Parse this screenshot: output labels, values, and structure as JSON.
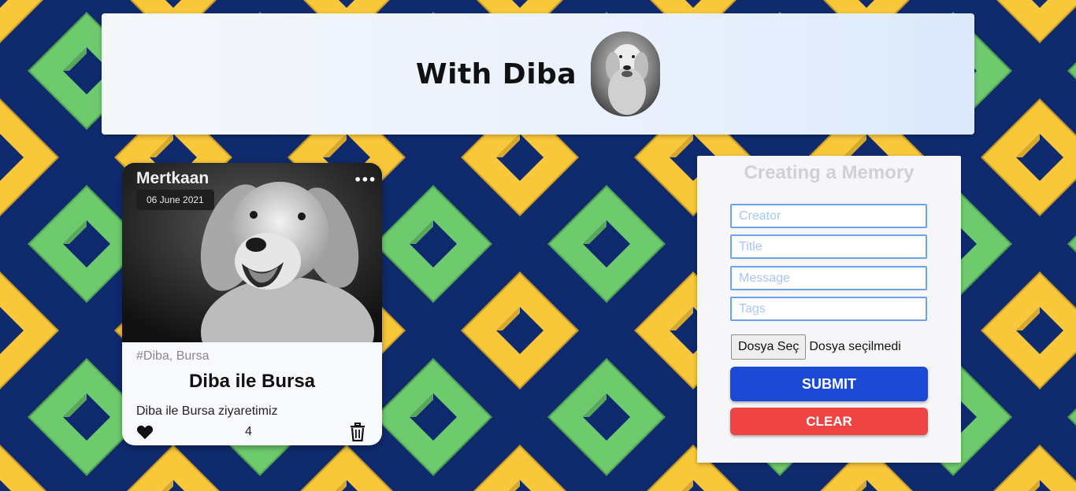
{
  "header": {
    "title": "With Diba"
  },
  "post": {
    "creator": "Mertkaan",
    "date": "06 June 2021",
    "tags": "#Diba, Bursa",
    "title": "Diba ile Bursa",
    "message": "Diba ile Bursa ziyaretimiz",
    "like_count": "4",
    "more_label": "•••"
  },
  "form": {
    "heading": "Creating a Memory",
    "fields": {
      "creator_placeholder": "Creator",
      "title_placeholder": "Title",
      "message_placeholder": "Message",
      "tags_placeholder": "Tags"
    },
    "file_button_label": "Dosya Seç",
    "file_status": "Dosya seçilmedi",
    "submit_label": "SUBMIT",
    "clear_label": "CLEAR"
  },
  "colors": {
    "background_navy": "#0f2b6e",
    "pattern_yellow": "#f9c73a",
    "pattern_green": "#6ecb6d",
    "submit_blue": "#1c4ad6",
    "clear_red": "#ee4444",
    "input_border": "#6aa3ea"
  },
  "icons": {
    "avatar": "dog-photo",
    "card_image": "dog-photo",
    "more": "more-horizontal-icon",
    "like": "heart-icon",
    "delete": "trash-icon"
  }
}
